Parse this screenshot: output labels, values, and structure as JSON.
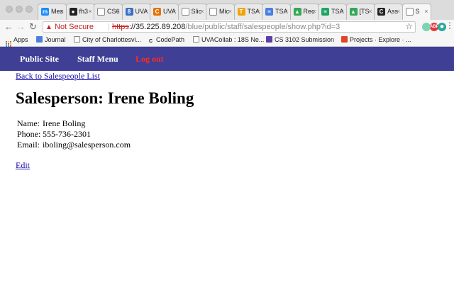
{
  "browser": {
    "tabs": [
      {
        "title": "Mes",
        "icon": "messenger-icon",
        "color": "#1a8cff",
        "glyph": "m"
      },
      {
        "title": "fh3",
        "icon": "github-icon",
        "color": "#222222",
        "glyph": "●"
      },
      {
        "title": "CS6",
        "icon": "document-icon",
        "color": "#ffffff",
        "glyph": ""
      },
      {
        "title": "UVA",
        "icon": "collab-icon",
        "color": "#3b6fc4",
        "glyph": "8"
      },
      {
        "title": "UVA",
        "icon": "uva-icon",
        "color": "#e57200",
        "glyph": "C"
      },
      {
        "title": "Slic",
        "icon": "document-icon",
        "color": "#ffffff",
        "glyph": ""
      },
      {
        "title": "Mic",
        "icon": "document-icon",
        "color": "#ffffff",
        "glyph": ""
      },
      {
        "title": "TSA",
        "icon": "tsa-icon",
        "color": "#f0a30a",
        "glyph": "T"
      },
      {
        "title": "TSA",
        "icon": "docs-icon",
        "color": "#4a7fe0",
        "glyph": "≡"
      },
      {
        "title": "Rec",
        "icon": "drive-icon",
        "color": "#34a853",
        "glyph": "▲"
      },
      {
        "title": "TSA",
        "icon": "sheets-icon",
        "color": "#1fa463",
        "glyph": "≡"
      },
      {
        "title": "[TS",
        "icon": "drive-icon",
        "color": "#34a853",
        "glyph": "▲"
      },
      {
        "title": "Ass",
        "icon": "codepath-icon",
        "color": "#222222",
        "glyph": "C"
      },
      {
        "title": "S",
        "icon": "document-icon",
        "color": "#ffffff",
        "glyph": ""
      }
    ],
    "address_bar": {
      "security_label": "Not Secure",
      "scheme": "https",
      "scheme_sep": "://",
      "host": "35.225.89.208",
      "path": "/blue/public/staff/salespeople/show.php?id=3"
    },
    "extensions": [
      {
        "icon": "extension-green-icon",
        "color": "#7ed3b2",
        "glyph": ""
      },
      {
        "icon": "adblock-icon",
        "color": "#e03a3a",
        "glyph": "ABP"
      },
      {
        "icon": "extension-teal-icon",
        "color": "#2aa79b",
        "glyph": "◉"
      }
    ],
    "bookmarks": [
      {
        "label": "Apps",
        "icon": "apps-grid-icon"
      },
      {
        "label": "Journal",
        "icon": "docs-icon",
        "color": "#4a7fe0"
      },
      {
        "label": "City of Charlottesvi...",
        "icon": "document-icon",
        "color": "#ffffff"
      },
      {
        "label": "CodePath",
        "icon": "codepath-icon",
        "color": "#222222"
      },
      {
        "label": "UVACollab : 18S Ne...",
        "icon": "document-icon",
        "color": "#ffffff"
      },
      {
        "label": "CS 3102 Submission",
        "icon": "submission-icon",
        "color": "#5b3ea8"
      },
      {
        "label": "Projects · Explore · ...",
        "icon": "gitlab-icon",
        "color": "#e24329"
      }
    ]
  },
  "site": {
    "nav": {
      "public_site": "Public Site",
      "staff_menu": "Staff Menu",
      "logout": "Log out"
    },
    "nav_color": "#3e3f95",
    "logout_color": "#ff2a2a",
    "back_link": "Back to Salespeople List",
    "title": "Salesperson: Irene Boling",
    "details": [
      {
        "label": "Name:",
        "value": "Irene Boling"
      },
      {
        "label": "Phone:",
        "value": "555-736-2301"
      },
      {
        "label": "Email:",
        "value": "iboling@salesperson.com"
      }
    ],
    "edit_link": "Edit"
  }
}
